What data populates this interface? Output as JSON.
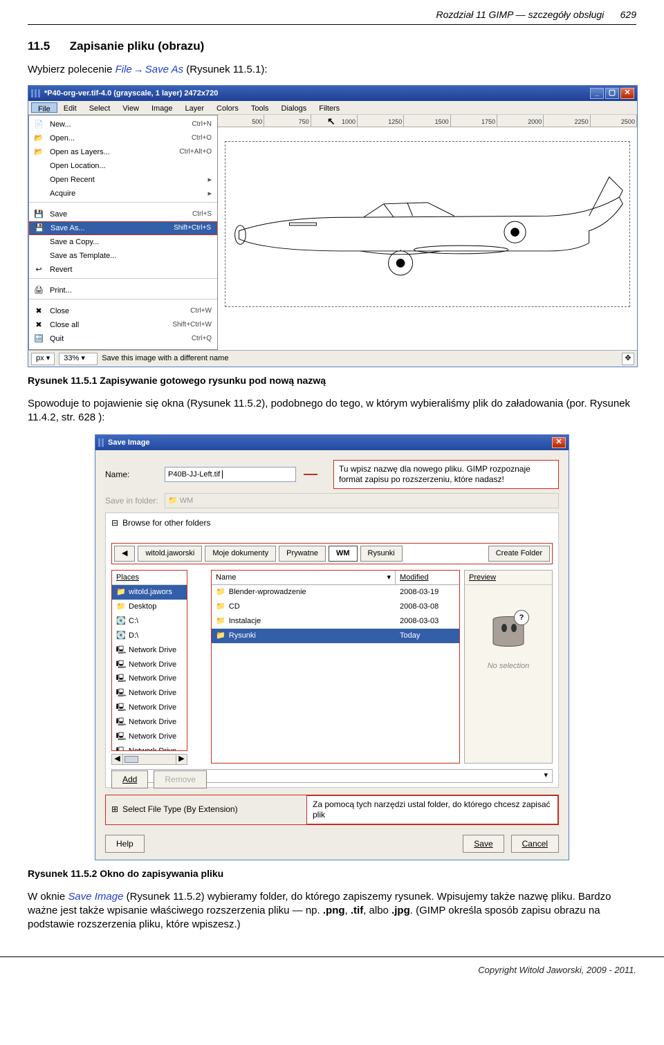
{
  "header": {
    "chapter": "Rozdział 11 GIMP — szczegóły obsługi",
    "pagenum": "629"
  },
  "section": {
    "num": "11.5",
    "title": "Zapisanie pliku (obrazu)",
    "intro_before_link": "Wybierz polecenie ",
    "link1": "File",
    "link2": "Save As",
    "intro_after_link": " (Rysunek 11.5.1):"
  },
  "caption1": "Rysunek 11.5.1 Zapisywanie gotowego rysunku pod nową nazwą",
  "para2a": "Spowoduje to pojawienie się okna (Rysunek 11.5.2), podobnego do tego, w którym wybieraliśmy plik do załadowania (por. Rysunek 11.4.2, str. 628 ):",
  "caption2": "Rysunek 11.5.2 Okno do zapisywania pliku",
  "para3": {
    "a": "W oknie ",
    "b": "Save Image",
    "c": " (Rysunek 11.5.2) wybieramy folder, do którego zapiszemy rysunek. Wpisujemy także nazwę pliku. Bardzo ważne jest także wpisanie właściwego rozszerzenia pliku — np. ",
    "ext1": ".png",
    "d": ", ",
    "ext2": ".tif",
    "e": ", albo ",
    "ext3": ".jpg",
    "f": ". (GIMP określa sposób zapisu obrazu na podstawie rozszerzenia pliku, które wpiszesz.)"
  },
  "footer": "Copyright Witold Jaworski, 2009 - 2011.",
  "gimpwin": {
    "title": "*P40-org-ver.tif-4.0 (grayscale, 1 layer) 2472x720",
    "menus": [
      "File",
      "Edit",
      "Select",
      "View",
      "Image",
      "Layer",
      "Colors",
      "Tools",
      "Dialogs",
      "Filters"
    ],
    "ruler": [
      "500",
      "750",
      "1000",
      "1250",
      "1500",
      "1750",
      "2000",
      "2250",
      "2500"
    ],
    "filemenu": [
      {
        "label": "New...",
        "sc": "Ctrl+N",
        "icon": "doc"
      },
      {
        "label": "Open...",
        "sc": "Ctrl+O",
        "icon": "open"
      },
      {
        "label": "Open as Layers...",
        "sc": "Ctrl+Alt+O",
        "icon": "open"
      },
      {
        "label": "Open Location...",
        "sc": "",
        "icon": ""
      },
      {
        "label": "Open Recent",
        "sc": "",
        "icon": "",
        "sub": true
      },
      {
        "label": "Acquire",
        "sc": "",
        "icon": "",
        "sub": true
      },
      {
        "sep": true
      },
      {
        "label": "Save",
        "sc": "Ctrl+S",
        "icon": "save"
      },
      {
        "label": "Save As...",
        "sc": "Shift+Ctrl+S",
        "icon": "save",
        "hl": true,
        "boxed": true
      },
      {
        "label": "Save a Copy...",
        "sc": "",
        "icon": ""
      },
      {
        "label": "Save as Template...",
        "sc": "",
        "icon": ""
      },
      {
        "label": "Revert",
        "sc": "",
        "icon": "revert"
      },
      {
        "sep": true
      },
      {
        "label": "Print...",
        "sc": "",
        "icon": "print"
      },
      {
        "sep": true
      },
      {
        "label": "Close",
        "sc": "Ctrl+W",
        "icon": "close"
      },
      {
        "label": "Close all",
        "sc": "Shift+Ctrl+W",
        "icon": "close"
      },
      {
        "label": "Quit",
        "sc": "Ctrl+Q",
        "icon": "quit"
      }
    ],
    "status": {
      "unit": "px",
      "zoom": "33%",
      "msg": "Save this image with a different name"
    }
  },
  "dialog": {
    "title": "Save Image",
    "name_lbl": "Name:",
    "name_val": "P40B-JJ-Left.tif",
    "saveinfolder_lbl": "Save in folder:",
    "saveinfolder_val": "WM",
    "annot1": "Tu wpisz nazwę dla nowego pliku. GIMP rozpoznaje format zapisu po rozszerzeniu, które nadasz!",
    "browse_label": "Browse for other folders",
    "path": [
      "witold.jaworski",
      "Moje dokumenty",
      "Prywatne",
      "WM",
      "Rysunki"
    ],
    "create_folder": "Create Folder",
    "places_hdr": "Places",
    "places": [
      {
        "label": "witold.jawors",
        "icon": "folder",
        "sel": true
      },
      {
        "label": "Desktop",
        "icon": "folder"
      },
      {
        "label": "C:\\",
        "icon": "drive"
      },
      {
        "label": "D:\\",
        "icon": "drive"
      },
      {
        "label": "Network Drive",
        "icon": "net"
      },
      {
        "label": "Network Drive",
        "icon": "net"
      },
      {
        "label": "Network Drive",
        "icon": "net"
      },
      {
        "label": "Network Drive",
        "icon": "net"
      },
      {
        "label": "Network Drive",
        "icon": "net"
      },
      {
        "label": "Network Drive",
        "icon": "net"
      },
      {
        "label": "Network Drive",
        "icon": "net"
      },
      {
        "label": "Network Drive",
        "icon": "net"
      }
    ],
    "name_hdr": "Name",
    "mod_hdr": "Modified",
    "files": [
      {
        "n": "Blender-wprowadzenie",
        "d": "2008-03-19"
      },
      {
        "n": "CD",
        "d": "2008-03-08"
      },
      {
        "n": "Instalacje",
        "d": "2008-03-03"
      },
      {
        "n": "Rysunki",
        "d": "Today",
        "today": true
      }
    ],
    "preview_hdr": "Preview",
    "preview_lbl": "No selection",
    "add": "Add",
    "remove": "Remove",
    "filetype": "Select File Type (By Extension)",
    "annot2": "Za pomocą tych narzędzi ustal folder, do którego chcesz zapisać plik",
    "help": "Help",
    "save": "Save",
    "cancel": "Cancel"
  }
}
